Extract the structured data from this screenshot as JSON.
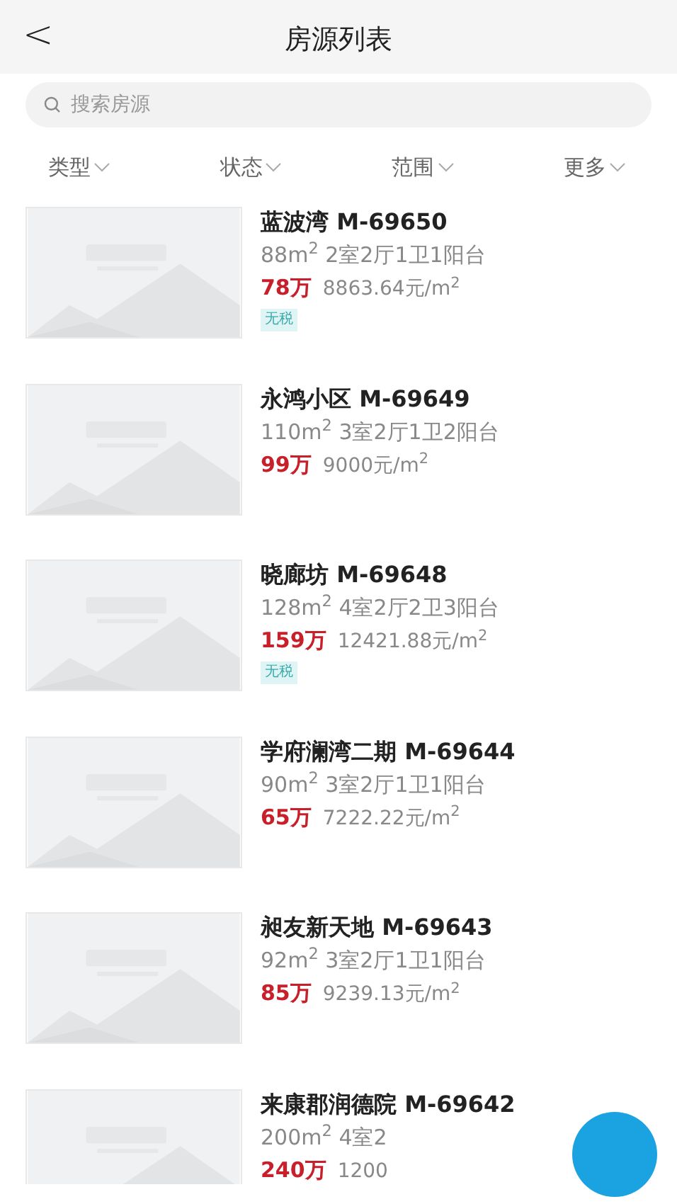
{
  "header": {
    "back": "<",
    "title": "房源列表"
  },
  "search": {
    "placeholder": "搜索房源"
  },
  "filters": [
    {
      "label": "类型"
    },
    {
      "label": "状态"
    },
    {
      "label": "范围"
    },
    {
      "label": "更多"
    }
  ],
  "listings": [
    {
      "title": "蓝波湾 M-69650",
      "specs": "88m$^{2}$ 2室2厅1卫1阳台",
      "price": "78万",
      "unit_price": "8863.64元/m$^{2}$",
      "tags": [
        "无税"
      ]
    },
    {
      "title": "永鸿小区 M-69649",
      "specs": "110m$^{2}$ 3室2厅1卫2阳台",
      "price": "99万",
      "unit_price": "9000元/m$^{2}$"
    },
    {
      "title": "晓廊坊 M-69648",
      "specs": "128m$^{2}$ 4室2厅2卫3阳台",
      "price": "159万",
      "unit_price": "12421.88元/m$^{2}$",
      "tags": [
        "无税"
      ]
    },
    {
      "title": "学府澜湾二期 M-69644",
      "specs": "90m$^{2}$ 3室2厅1卫1阳台",
      "price": "65万",
      "unit_price": "7222.22元/m$^{2}$"
    },
    {
      "title": "昶友新天地 M-69643",
      "specs": "92m$^{2}$ 3室2厅1卫1阳台",
      "price": "85万",
      "unit_price": "9239.13元/m$^{2}$"
    },
    {
      "title": "来康郡润德院 M-69642",
      "specs": "200m$^{2}$ 4室2",
      "price": "240万",
      "unit_price": "1200"
    }
  ],
  "floating_button": {
    "kind": "round"
  }
}
